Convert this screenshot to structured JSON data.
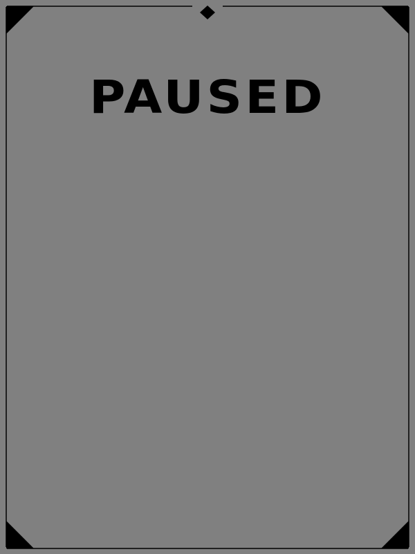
{
  "screen": {
    "background_color": "#808080",
    "frame_color": "#000000",
    "title": "PAUSED"
  },
  "icons": {
    "top_ornament": "diamond-icon",
    "corners": [
      "corner-top-left",
      "corner-top-right",
      "corner-bottom-left",
      "corner-bottom-right"
    ]
  }
}
